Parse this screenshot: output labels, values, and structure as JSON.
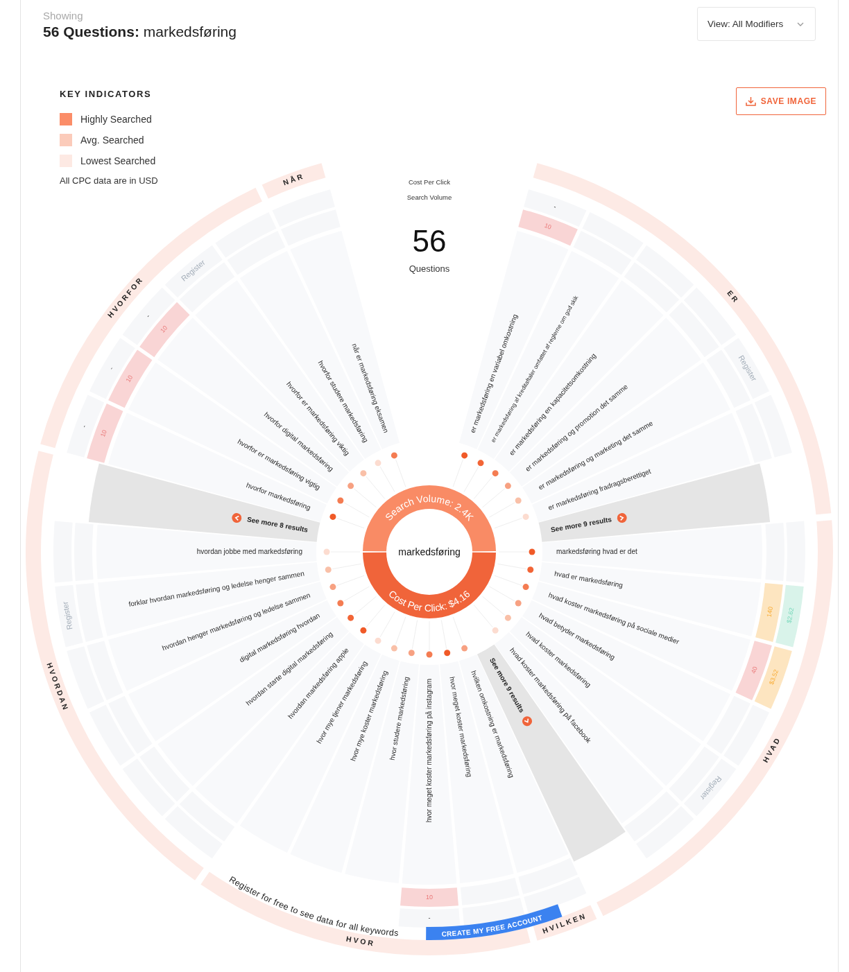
{
  "header": {
    "eyebrow": "Showing",
    "title": "**56 Questions:** markedsføring"
  },
  "view_select": {
    "value": "View: All Modifiers"
  },
  "save_button": "SAVE IMAGE",
  "legend": {
    "title": "KEY INDICATORS",
    "items": [
      {
        "label": "Highly Searched",
        "color": "#fb8d68"
      },
      {
        "label": "Avg. Searched",
        "color": "#fbcbba"
      },
      {
        "label": "Lowest Searched",
        "color": "#fde9e3"
      }
    ],
    "note": "All CPC data are in USD"
  },
  "summary": {
    "cpc_label": "Cost Per Click",
    "volume_label": "Search Volume",
    "count": "56",
    "count_label": "Questions"
  },
  "center": {
    "keyword": "markedsføring",
    "volume_label": "Search Volume: 2.4K",
    "cpc_label": "Cost Per Click: $4.16"
  },
  "groups": [
    {
      "label": "ER",
      "register_label": "Register",
      "more": "See more 9 results",
      "questions": [
        {
          "text": "er markedsføring en variabel omkostning",
          "color": "#f05a28",
          "volume": {
            "text": "10",
            "color": "#f9d5d5"
          },
          "cpc": {
            "text": "-"
          }
        },
        {
          "text": "er markedsføring af kreditaftaler omfattet af reglerne om god skik",
          "color": "#f26536"
        },
        {
          "text": "er markedsføring en kapacitetsomkostning",
          "color": "#f47c52"
        },
        {
          "text": "er markedsføring og promotion det samme",
          "color": "#f7a182"
        },
        {
          "text": "er markedsføring og marketing det samme",
          "color": "#f9c0a8"
        },
        {
          "text": "er markedsføring fradragsberettiget",
          "color": "#fcdcd0"
        }
      ]
    },
    {
      "label": "HVAD",
      "register_label": "Register",
      "more": "See more 9 results",
      "questions": [
        {
          "text": "markedsføring hvad er det",
          "color": "#f05a28"
        },
        {
          "text": "hvad er markedsføring",
          "color": "#f26536",
          "volume": {
            "text": "140",
            "color": "#fde5c0"
          },
          "cpc": {
            "text": "$2.62",
            "color": "#d9f3ea"
          }
        },
        {
          "text": "hvad koster markedsføring på sociale medier",
          "color": "#f47c52",
          "volume": {
            "text": "40",
            "color": "#f9d5d5"
          },
          "cpc": {
            "text": "$3.52",
            "color": "#fde5c0"
          }
        },
        {
          "text": "hvad betyder markedsføring",
          "color": "#f7a182"
        },
        {
          "text": "hvad koster markedsføring",
          "color": "#f9c0a8"
        },
        {
          "text": "hvad koster markedsføring på facebook",
          "color": "#fcdcd0"
        }
      ]
    },
    {
      "label": "HVILKEN",
      "questions": [
        {
          "text": "hvilken omkostning er markedsføring",
          "color": "#f7a182"
        }
      ]
    },
    {
      "label": "HVOR",
      "questions": [
        {
          "text": "hvor meget koster markedsføring",
          "color": "#f05a28"
        },
        {
          "text": "hvor meget koster markedsføring på instagram",
          "color": "#f47c52",
          "volume": {
            "text": "10",
            "color": "#f9d5d5"
          },
          "cpc": {
            "text": "-"
          }
        },
        {
          "text": "hvor studere markedsføring",
          "color": "#f7a182"
        },
        {
          "text": "hvor mye koster markedsføring",
          "color": "#f9c0a8"
        },
        {
          "text": "hvor mye tjener markedsføring",
          "color": "#fcdcd0"
        }
      ]
    },
    {
      "label": "HVORDAN",
      "register_label": "Register",
      "more": "See more 8 results",
      "questions": [
        {
          "text": "hvordan markedsføring apple",
          "color": "#f05a28"
        },
        {
          "text": "hvordan starte digital markedsføring",
          "color": "#f26536"
        },
        {
          "text": "digital markedsføring hvordan",
          "color": "#f47c52"
        },
        {
          "text": "hvordan henger markedsføring og ledelse sammen",
          "color": "#f7a182"
        },
        {
          "text": "forklar hvordan markedsføring og ledelse henger sammen",
          "color": "#f9c0a8"
        },
        {
          "text": "hvordan jobbe med markedsføring",
          "color": "#fcdcd0"
        }
      ]
    },
    {
      "label": "HVORFOR",
      "register_label": "Register",
      "questions": [
        {
          "text": "hvorfor markedsføring",
          "color": "#f05a28",
          "volume": {
            "text": "10",
            "color": "#f9d5d5"
          },
          "cpc": {
            "text": "-"
          }
        },
        {
          "text": "hvorfor er markedsføring vigtig",
          "color": "#f47c52",
          "volume": {
            "text": "10",
            "color": "#f9d5d5"
          },
          "cpc": {
            "text": "-"
          }
        },
        {
          "text": "hvorfor digital markedsføring",
          "color": "#f7a182",
          "volume": {
            "text": "10",
            "color": "#f9d5d5"
          },
          "cpc": {
            "text": "-"
          }
        },
        {
          "text": "hvorfor er markedsføring viktig",
          "color": "#f9c0a8"
        },
        {
          "text": "hvorfor studere markedsføring",
          "color": "#fcdcd0"
        }
      ]
    },
    {
      "label": "NÅR",
      "questions": [
        {
          "text": "når er markedsføring eksamen",
          "color": "#f47c52"
        }
      ]
    }
  ],
  "register_prompt": "Register for free to see data for all keywords",
  "cta": "CREATE MY FREE ACCOUNT"
}
